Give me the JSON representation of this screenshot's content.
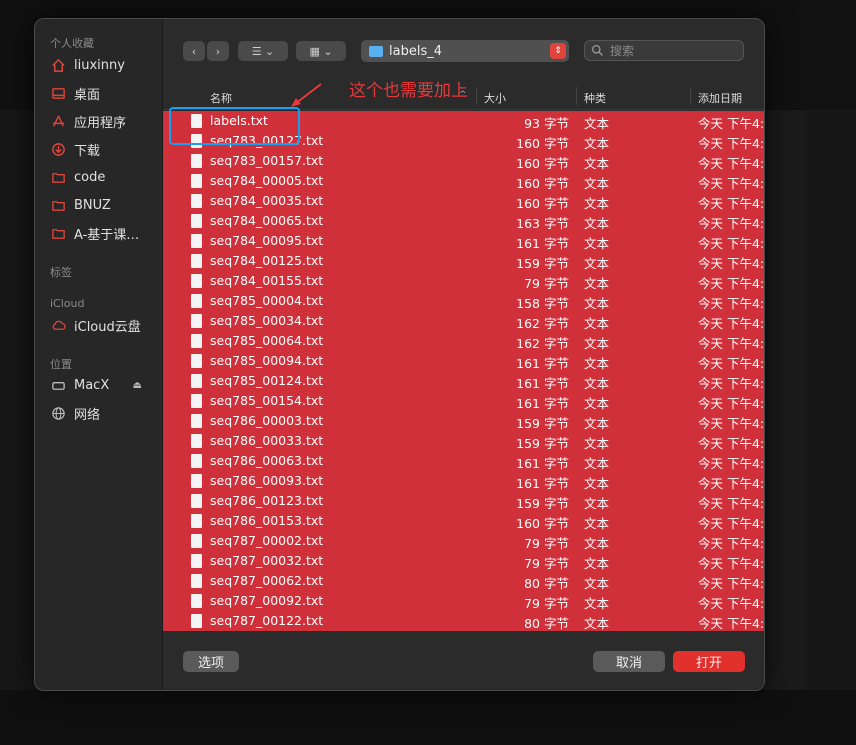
{
  "sidebar": {
    "favorites_header": "个人收藏",
    "favorites": [
      {
        "label": "liuxinny",
        "icon": "home-icon"
      },
      {
        "label": "桌面",
        "icon": "desktop-icon"
      },
      {
        "label": "应用程序",
        "icon": "applications-icon"
      },
      {
        "label": "下载",
        "icon": "download-icon"
      },
      {
        "label": "code",
        "icon": "folder-icon"
      },
      {
        "label": "BNUZ",
        "icon": "folder-icon"
      },
      {
        "label": "A-基于课…",
        "icon": "folder-icon"
      }
    ],
    "tags_header": "标签",
    "icloud_header": "iCloud",
    "icloud_items": [
      {
        "label": "iCloud云盘",
        "icon": "cloud-icon"
      }
    ],
    "locations_header": "位置",
    "locations": [
      {
        "label": "MacX",
        "icon": "drive-icon"
      },
      {
        "label": "网络",
        "icon": "network-icon"
      }
    ]
  },
  "toolbar": {
    "current_folder": "labels_4",
    "search_placeholder": "搜索"
  },
  "columns": {
    "name": "名称",
    "size": "大小",
    "kind": "种类",
    "date_added": "添加日期"
  },
  "files": [
    {
      "name": "labels.txt",
      "size": "93 字节",
      "kind": "文本",
      "date": "今天 下午4:"
    },
    {
      "name": "seq783_00127.txt",
      "size": "160 字节",
      "kind": "文本",
      "date": "今天 下午4:"
    },
    {
      "name": "seq783_00157.txt",
      "size": "160 字节",
      "kind": "文本",
      "date": "今天 下午4:"
    },
    {
      "name": "seq784_00005.txt",
      "size": "160 字节",
      "kind": "文本",
      "date": "今天 下午4:"
    },
    {
      "name": "seq784_00035.txt",
      "size": "160 字节",
      "kind": "文本",
      "date": "今天 下午4:"
    },
    {
      "name": "seq784_00065.txt",
      "size": "163 字节",
      "kind": "文本",
      "date": "今天 下午4:"
    },
    {
      "name": "seq784_00095.txt",
      "size": "161 字节",
      "kind": "文本",
      "date": "今天 下午4:"
    },
    {
      "name": "seq784_00125.txt",
      "size": "159 字节",
      "kind": "文本",
      "date": "今天 下午4:"
    },
    {
      "name": "seq784_00155.txt",
      "size": "79 字节",
      "kind": "文本",
      "date": "今天 下午4:"
    },
    {
      "name": "seq785_00004.txt",
      "size": "158 字节",
      "kind": "文本",
      "date": "今天 下午4:"
    },
    {
      "name": "seq785_00034.txt",
      "size": "162 字节",
      "kind": "文本",
      "date": "今天 下午4:"
    },
    {
      "name": "seq785_00064.txt",
      "size": "162 字节",
      "kind": "文本",
      "date": "今天 下午4:"
    },
    {
      "name": "seq785_00094.txt",
      "size": "161 字节",
      "kind": "文本",
      "date": "今天 下午4:"
    },
    {
      "name": "seq785_00124.txt",
      "size": "161 字节",
      "kind": "文本",
      "date": "今天 下午4:"
    },
    {
      "name": "seq785_00154.txt",
      "size": "161 字节",
      "kind": "文本",
      "date": "今天 下午4:"
    },
    {
      "name": "seq786_00003.txt",
      "size": "159 字节",
      "kind": "文本",
      "date": "今天 下午4:"
    },
    {
      "name": "seq786_00033.txt",
      "size": "159 字节",
      "kind": "文本",
      "date": "今天 下午4:"
    },
    {
      "name": "seq786_00063.txt",
      "size": "161 字节",
      "kind": "文本",
      "date": "今天 下午4:"
    },
    {
      "name": "seq786_00093.txt",
      "size": "161 字节",
      "kind": "文本",
      "date": "今天 下午4:"
    },
    {
      "name": "seq786_00123.txt",
      "size": "159 字节",
      "kind": "文本",
      "date": "今天 下午4:"
    },
    {
      "name": "seq786_00153.txt",
      "size": "160 字节",
      "kind": "文本",
      "date": "今天 下午4:"
    },
    {
      "name": "seq787_00002.txt",
      "size": "79 字节",
      "kind": "文本",
      "date": "今天 下午4:"
    },
    {
      "name": "seq787_00032.txt",
      "size": "79 字节",
      "kind": "文本",
      "date": "今天 下午4:"
    },
    {
      "name": "seq787_00062.txt",
      "size": "80 字节",
      "kind": "文本",
      "date": "今天 下午4:"
    },
    {
      "name": "seq787_00092.txt",
      "size": "79 字节",
      "kind": "文本",
      "date": "今天 下午4:"
    },
    {
      "name": "seq787_00122.txt",
      "size": "80 字节",
      "kind": "文本",
      "date": "今天 下午4:"
    }
  ],
  "footer": {
    "options_label": "选项",
    "cancel_label": "取消",
    "open_label": "打开"
  },
  "annotation": {
    "text": "这个也需要加上",
    "color": "#e8383a",
    "highlight_color": "#1e9cf0"
  },
  "colors": {
    "selection": "#d0303a",
    "accent": "#e2302d"
  }
}
